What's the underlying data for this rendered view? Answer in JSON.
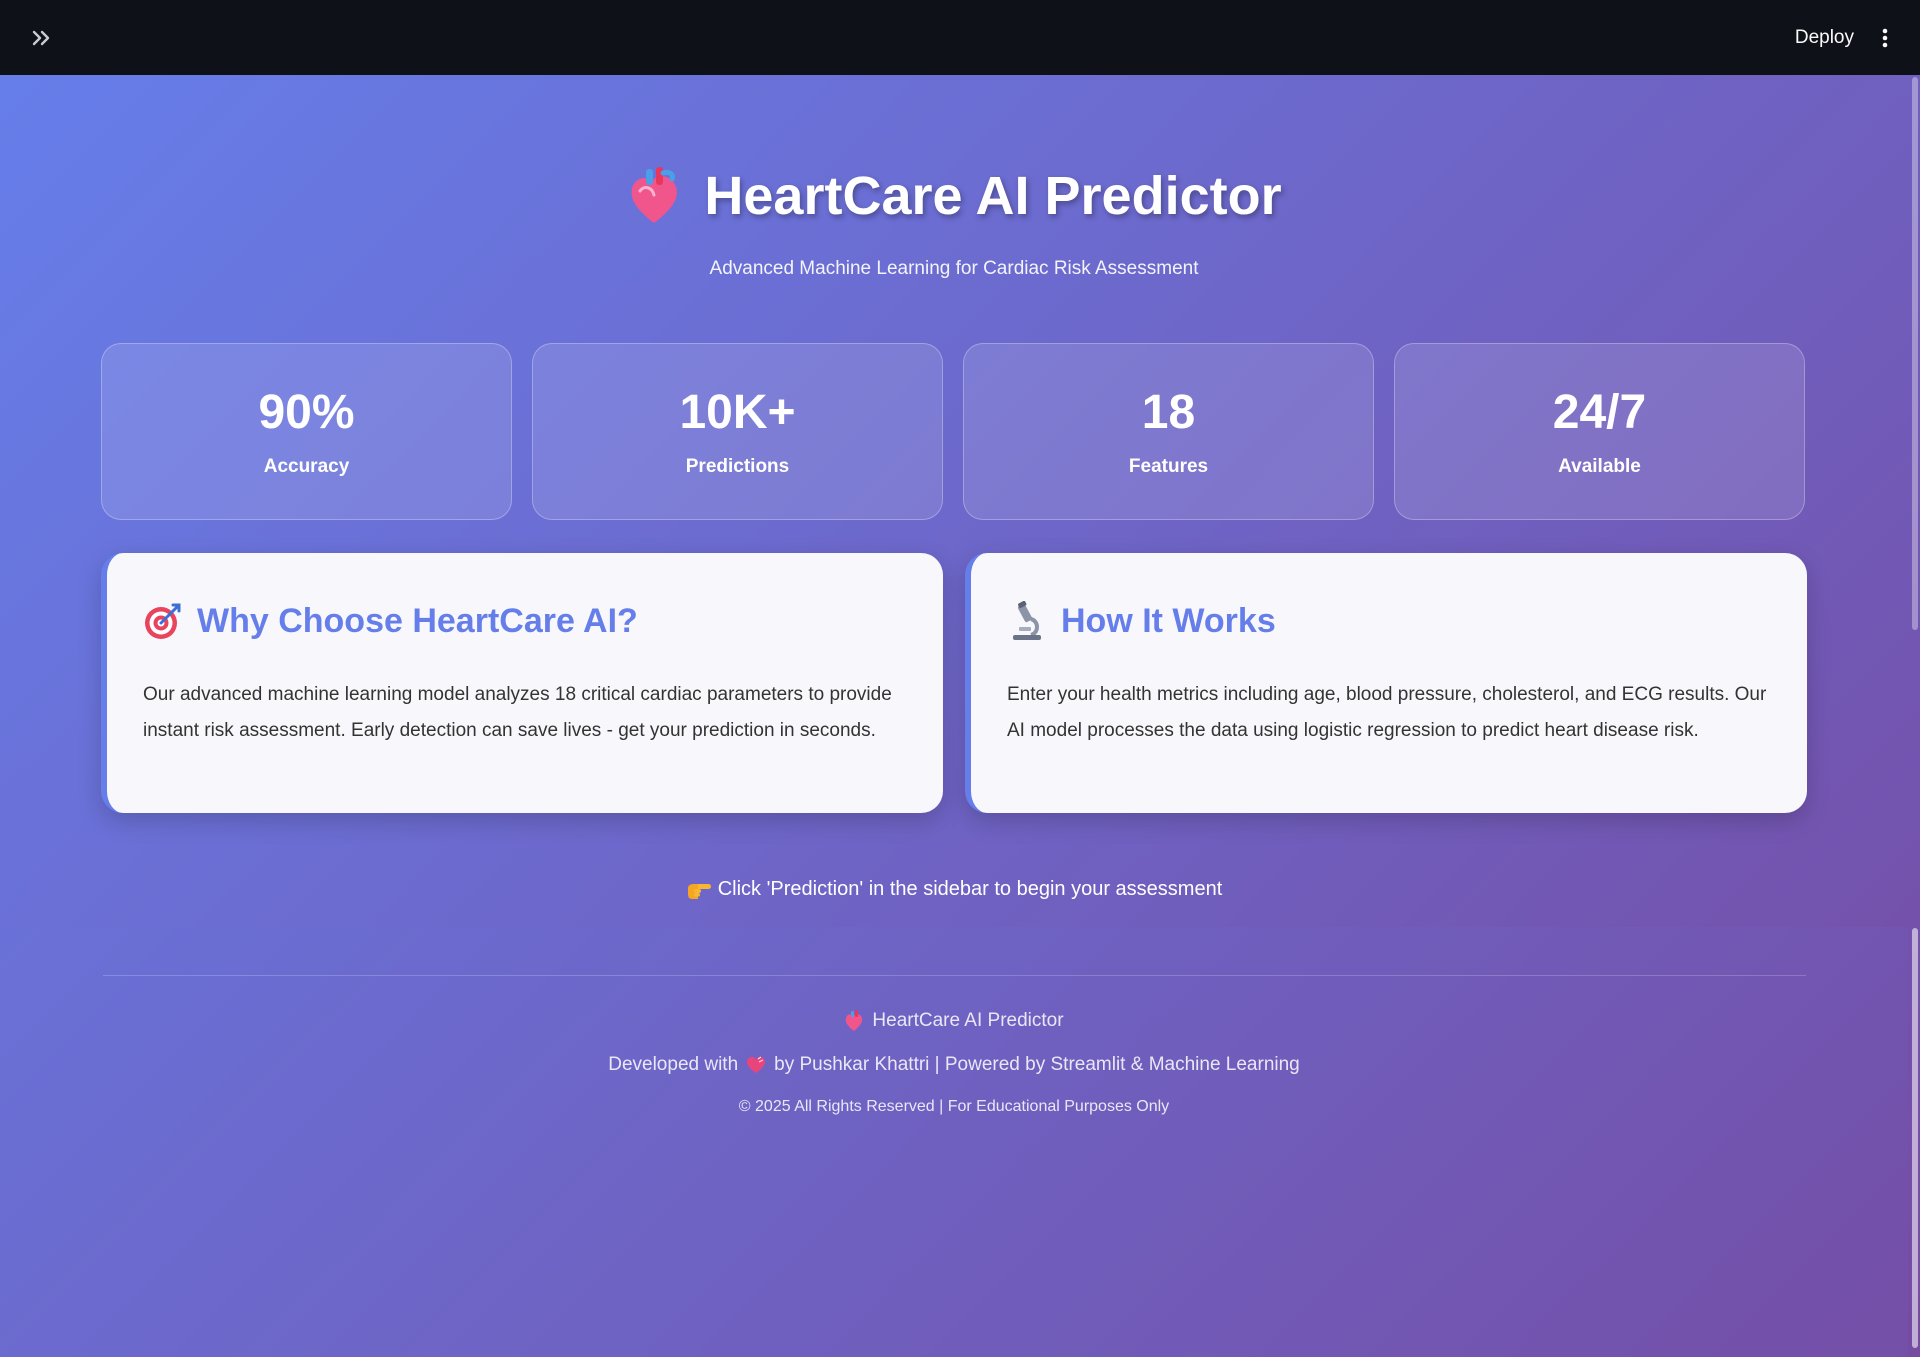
{
  "topbar": {
    "deploy_label": "Deploy"
  },
  "hero": {
    "title": "HeartCare AI Predictor",
    "subtitle": "Advanced Machine Learning for Cardiac Risk Assessment"
  },
  "stats": [
    {
      "value": "90%",
      "label": "Accuracy"
    },
    {
      "value": "10K+",
      "label": "Predictions"
    },
    {
      "value": "18",
      "label": "Features"
    },
    {
      "value": "24/7",
      "label": "Available"
    }
  ],
  "cards": [
    {
      "icon": "target-icon",
      "title": "Why Choose HeartCare AI?",
      "body": "Our advanced machine learning model analyzes 18 critical cardiac parameters to provide instant risk assessment. Early detection can save lives - get your prediction in seconds."
    },
    {
      "icon": "microscope-icon",
      "title": "How It Works",
      "body": "Enter your health metrics including age, blood pressure, cholesterol, and ECG results. Our AI model processes the data using logistic regression to predict heart disease risk."
    }
  ],
  "cta": {
    "text": "Click 'Prediction' in the sidebar to begin your assessment"
  },
  "footer": {
    "app_name": "HeartCare AI Predictor",
    "developed_prefix": "Developed with",
    "developed_suffix": "by Pushkar Khattri | Powered by Streamlit & Machine Learning",
    "copyright": "© 2025 All Rights Reserved | For Educational Purposes Only"
  },
  "colors": {
    "gradient_start": "#667eea",
    "gradient_end": "#764ba2",
    "heading": "#667eea",
    "topbar": "#0e1117"
  }
}
